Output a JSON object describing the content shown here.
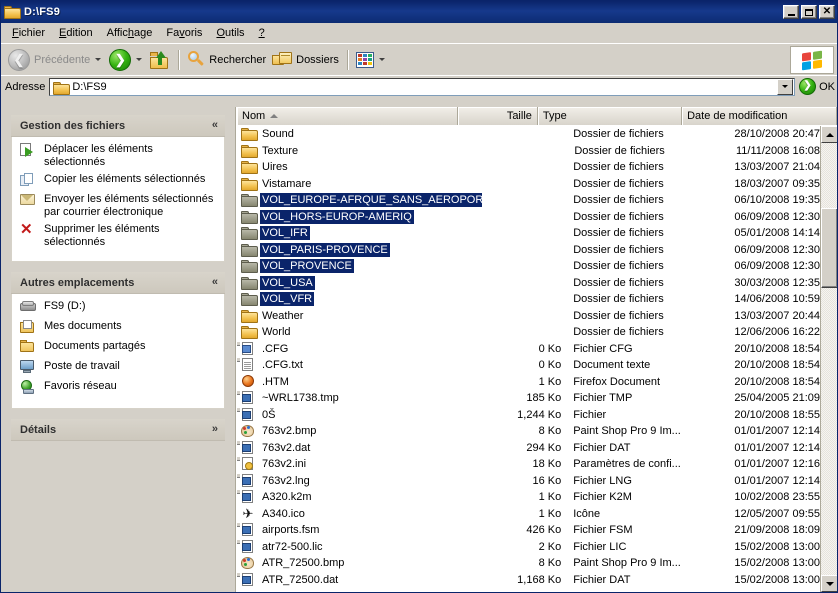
{
  "window": {
    "title": "D:\\FS9",
    "title_icon": "folder-icon",
    "minimize_label": "_",
    "maximize_label": "□",
    "close_label": "✕"
  },
  "menu": {
    "items": [
      {
        "label": "Fichier",
        "accel": "F"
      },
      {
        "label": "Edition",
        "accel": "E"
      },
      {
        "label": "Affichage",
        "accel": "h"
      },
      {
        "label": "Favoris",
        "accel": "v"
      },
      {
        "label": "Outils",
        "accel": "O"
      },
      {
        "label": "?",
        "accel": ""
      }
    ]
  },
  "toolbar": {
    "back_label": "Précédente",
    "forward_label": "",
    "up_label": "",
    "search_label": "Rechercher",
    "folders_label": "Dossiers",
    "views_label": ""
  },
  "address": {
    "label": "Adresse",
    "value": "D:\\FS9",
    "go_label": "OK"
  },
  "sidebar": {
    "panels": [
      {
        "title": "Gestion des fichiers",
        "collapse_glyph": "«",
        "items": [
          {
            "icon": "move-items-icon",
            "label": "Déplacer les éléments sélectionnés"
          },
          {
            "icon": "copy-items-icon",
            "label": "Copier les éléments sélectionnés"
          },
          {
            "icon": "email-items-icon",
            "label": "Envoyer les éléments sélectionnés par courrier électronique"
          },
          {
            "icon": "delete-items-icon",
            "label": "Supprimer les éléments sélectionnés"
          }
        ]
      },
      {
        "title": "Autres emplacements",
        "collapse_glyph": "«",
        "items": [
          {
            "icon": "drive-icon",
            "label": "FS9 (D:)"
          },
          {
            "icon": "my-documents-icon",
            "label": "Mes documents"
          },
          {
            "icon": "shared-documents-icon",
            "label": "Documents partagés"
          },
          {
            "icon": "my-computer-icon",
            "label": "Poste de travail"
          },
          {
            "icon": "network-places-icon",
            "label": "Favoris réseau"
          }
        ]
      },
      {
        "title": "Détails",
        "collapse_glyph": "»",
        "items": []
      }
    ]
  },
  "filelist": {
    "columns": [
      {
        "label": "Nom",
        "sorted": true
      },
      {
        "label": "Taille",
        "sorted": false
      },
      {
        "label": "Type",
        "sorted": false
      },
      {
        "label": "Date de modification",
        "sorted": false
      }
    ],
    "rows": [
      {
        "icon": "folder-icon",
        "name": "Sound",
        "size": "",
        "type": "Dossier de fichiers",
        "date": "28/10/2008 20:47",
        "selected": false
      },
      {
        "icon": "folder-icon",
        "name": "Texture",
        "size": "",
        "type": "Dossier de fichiers",
        "date": "11/11/2008 16:08",
        "selected": false
      },
      {
        "icon": "folder-icon",
        "name": "Uires",
        "size": "",
        "type": "Dossier de fichiers",
        "date": "13/03/2007 21:04",
        "selected": false
      },
      {
        "icon": "folder-icon",
        "name": "Vistamare",
        "size": "",
        "type": "Dossier de fichiers",
        "date": "18/03/2007 09:35",
        "selected": false
      },
      {
        "icon": "folder-icon-dark",
        "name": "VOL_EUROPE-AFRQUE_SANS_AEROPORTS",
        "size": "",
        "type": "Dossier de fichiers",
        "date": "06/10/2008 19:35",
        "selected": true
      },
      {
        "icon": "folder-icon-dark",
        "name": "VOL_HORS-EUROP-AMERIQ",
        "size": "",
        "type": "Dossier de fichiers",
        "date": "06/09/2008 12:30",
        "selected": true
      },
      {
        "icon": "folder-icon-dark",
        "name": "VOL_IFR",
        "size": "",
        "type": "Dossier de fichiers",
        "date": "05/01/2008 14:14",
        "selected": true
      },
      {
        "icon": "folder-icon-dark",
        "name": "VOL_PARIS-PROVENCE",
        "size": "",
        "type": "Dossier de fichiers",
        "date": "06/09/2008 12:30",
        "selected": true
      },
      {
        "icon": "folder-icon-dark",
        "name": "VOL_PROVENCE",
        "size": "",
        "type": "Dossier de fichiers",
        "date": "06/09/2008 12:30",
        "selected": true
      },
      {
        "icon": "folder-icon-dark",
        "name": "VOL_USA",
        "size": "",
        "type": "Dossier de fichiers",
        "date": "30/03/2008 12:35",
        "selected": true
      },
      {
        "icon": "folder-icon-dark",
        "name": "VOL_VFR",
        "size": "",
        "type": "Dossier de fichiers",
        "date": "14/06/2008 10:59",
        "selected": true
      },
      {
        "icon": "folder-icon",
        "name": "Weather",
        "size": "",
        "type": "Dossier de fichiers",
        "date": "13/03/2007 20:44",
        "selected": false
      },
      {
        "icon": "folder-icon",
        "name": "World",
        "size": "",
        "type": "Dossier de fichiers",
        "date": "12/06/2006 16:22",
        "selected": false
      },
      {
        "icon": "cfg-file-icon",
        "name": ".CFG",
        "size": "0 Ko",
        "type": "Fichier CFG",
        "date": "20/10/2008 18:54",
        "selected": false
      },
      {
        "icon": "text-document-icon",
        "name": ".CFG.txt",
        "size": "0 Ko",
        "type": "Document texte",
        "date": "20/10/2008 18:54",
        "selected": false
      },
      {
        "icon": "firefox-document-icon",
        "name": ".HTM",
        "size": "1 Ko",
        "type": "Firefox Document",
        "date": "20/10/2008 18:54",
        "selected": false
      },
      {
        "icon": "generic-file-icon",
        "name": "~WRL1738.tmp",
        "size": "185 Ko",
        "type": "Fichier TMP",
        "date": "25/04/2005 21:09",
        "selected": false
      },
      {
        "icon": "generic-file-icon",
        "name": "0Š",
        "size": "1,244 Ko",
        "type": "Fichier",
        "date": "20/10/2008 18:55",
        "selected": false
      },
      {
        "icon": "paint-shop-pro-icon",
        "name": "763v2.bmp",
        "size": "8 Ko",
        "type": "Paint Shop Pro 9 Im...",
        "date": "01/01/2007 12:14",
        "selected": false
      },
      {
        "icon": "generic-file-icon",
        "name": "763v2.dat",
        "size": "294 Ko",
        "type": "Fichier DAT",
        "date": "01/01/2007 12:14",
        "selected": false
      },
      {
        "icon": "config-settings-icon",
        "name": "763v2.ini",
        "size": "18 Ko",
        "type": "Paramètres de confi...",
        "date": "01/01/2007 12:16",
        "selected": false
      },
      {
        "icon": "generic-file-icon",
        "name": "763v2.lng",
        "size": "16 Ko",
        "type": "Fichier LNG",
        "date": "01/01/2007 12:14",
        "selected": false
      },
      {
        "icon": "generic-file-icon",
        "name": "A320.k2m",
        "size": "1 Ko",
        "type": "Fichier K2M",
        "date": "10/02/2008 23:55",
        "selected": false
      },
      {
        "icon": "airplane-icon",
        "name": "A340.ico",
        "size": "1 Ko",
        "type": "Icône",
        "date": "12/05/2007 09:55",
        "selected": false
      },
      {
        "icon": "generic-file-icon",
        "name": "airports.fsm",
        "size": "426 Ko",
        "type": "Fichier FSM",
        "date": "21/09/2008 18:09",
        "selected": false
      },
      {
        "icon": "generic-file-icon",
        "name": "atr72-500.lic",
        "size": "2 Ko",
        "type": "Fichier LIC",
        "date": "15/02/2008 13:00",
        "selected": false
      },
      {
        "icon": "paint-shop-pro-icon",
        "name": "ATR_72500.bmp",
        "size": "8 Ko",
        "type": "Paint Shop Pro 9 Im...",
        "date": "15/02/2008 13:00",
        "selected": false
      },
      {
        "icon": "generic-file-icon",
        "name": "ATR_72500.dat",
        "size": "1,168 Ko",
        "type": "Fichier DAT",
        "date": "15/02/2008 13:00",
        "selected": false
      }
    ]
  },
  "colors": {
    "titlebar_start": "#0a246a",
    "titlebar_end": "#0c2b72",
    "selection": "#0a246a",
    "chrome": "#d4d0c8",
    "panel_header": "#cdc8bd",
    "list_background": "#ffffff"
  }
}
